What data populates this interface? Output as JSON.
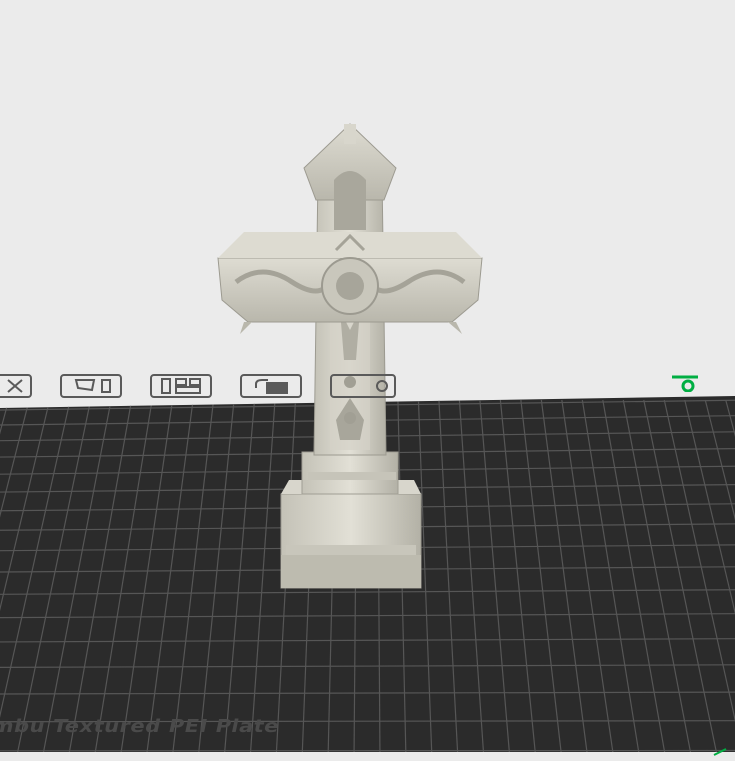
{
  "scene": {
    "background": "#ebebeb",
    "plate_color": "#2b2b2b",
    "grid_color": "#555555",
    "model_color": "#cfcdc2",
    "accent_color": "#00ae42"
  },
  "plate": {
    "label": "mbu Textured PEI Plate",
    "icons": [
      {
        "name": "close-plate-icon"
      },
      {
        "name": "auto-orient-icon"
      },
      {
        "name": "arrange-icon"
      },
      {
        "name": "lock-icon"
      },
      {
        "name": "settings-icon"
      }
    ]
  },
  "model": {
    "name": "gothic-cross"
  }
}
